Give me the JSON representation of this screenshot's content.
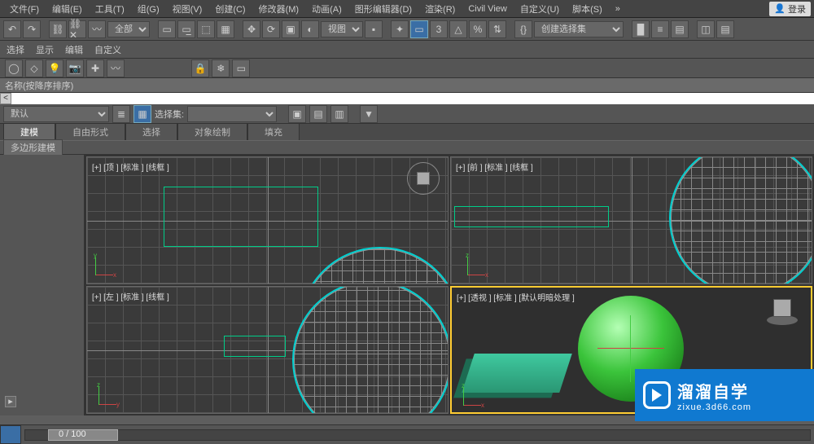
{
  "menu": {
    "items": [
      "文件(F)",
      "编辑(E)",
      "工具(T)",
      "组(G)",
      "视图(V)",
      "创建(C)",
      "修改器(M)",
      "动画(A)",
      "图形编辑器(D)",
      "渲染(R)",
      "Civil View",
      "自定义(U)",
      "脚本(S)"
    ],
    "login": "登录"
  },
  "toolbar1": {
    "filter": "全部",
    "coordsys": "视图",
    "createset": "创建选择集"
  },
  "submenu": {
    "items": [
      "选择",
      "显示",
      "编辑",
      "自定义"
    ]
  },
  "namesort": {
    "label": "名称(按降序排序)"
  },
  "selset": {
    "default": "默认",
    "label": "选择集:"
  },
  "tabs": {
    "items": [
      "建模",
      "自由形式",
      "选择",
      "对象绘制",
      "填充"
    ],
    "active": 0
  },
  "subtab": {
    "label": "多边形建模"
  },
  "viewports": {
    "tl": "[+] [顶 ] [标准 ] [线框 ]",
    "tr": "[+] [前 ] [标准 ] [线框 ]",
    "bl": "[+] [左 ] [标准 ] [线框 ]",
    "br": "[+] [透视 ] [标准 ] [默认明暗处理 ]"
  },
  "axis": {
    "x": "x",
    "y": "y",
    "z": "z"
  },
  "timeline": {
    "frame": "0 / 100"
  },
  "watermark": {
    "title": "溜溜自学",
    "url": "zixue.3d66.com"
  }
}
